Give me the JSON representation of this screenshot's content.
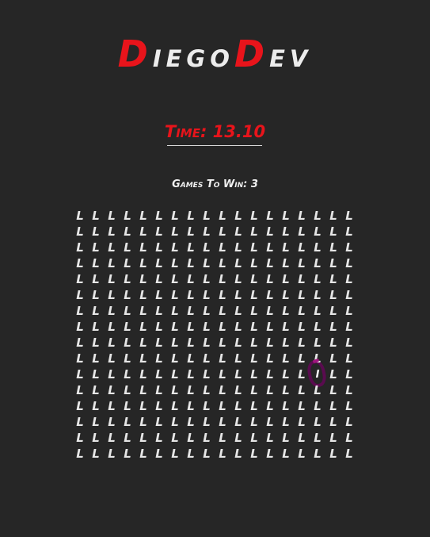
{
  "logo": {
    "part1_initial": "D",
    "part1_rest": "iego",
    "part2_initial": "D",
    "part2_rest": "ev"
  },
  "timer": {
    "text": "Time: 13.10"
  },
  "status": {
    "games_to_win": "Games To Win: 3"
  },
  "grid": {
    "rows": 16,
    "cols": 18,
    "glyph": "L",
    "target_glyph": "I",
    "target_row": 10,
    "target_col": 15
  },
  "colors": {
    "background": "#262626",
    "accent_red": "#e8141b",
    "text_light": "#e6e6e6",
    "target_ring": "#5a0b4f"
  }
}
